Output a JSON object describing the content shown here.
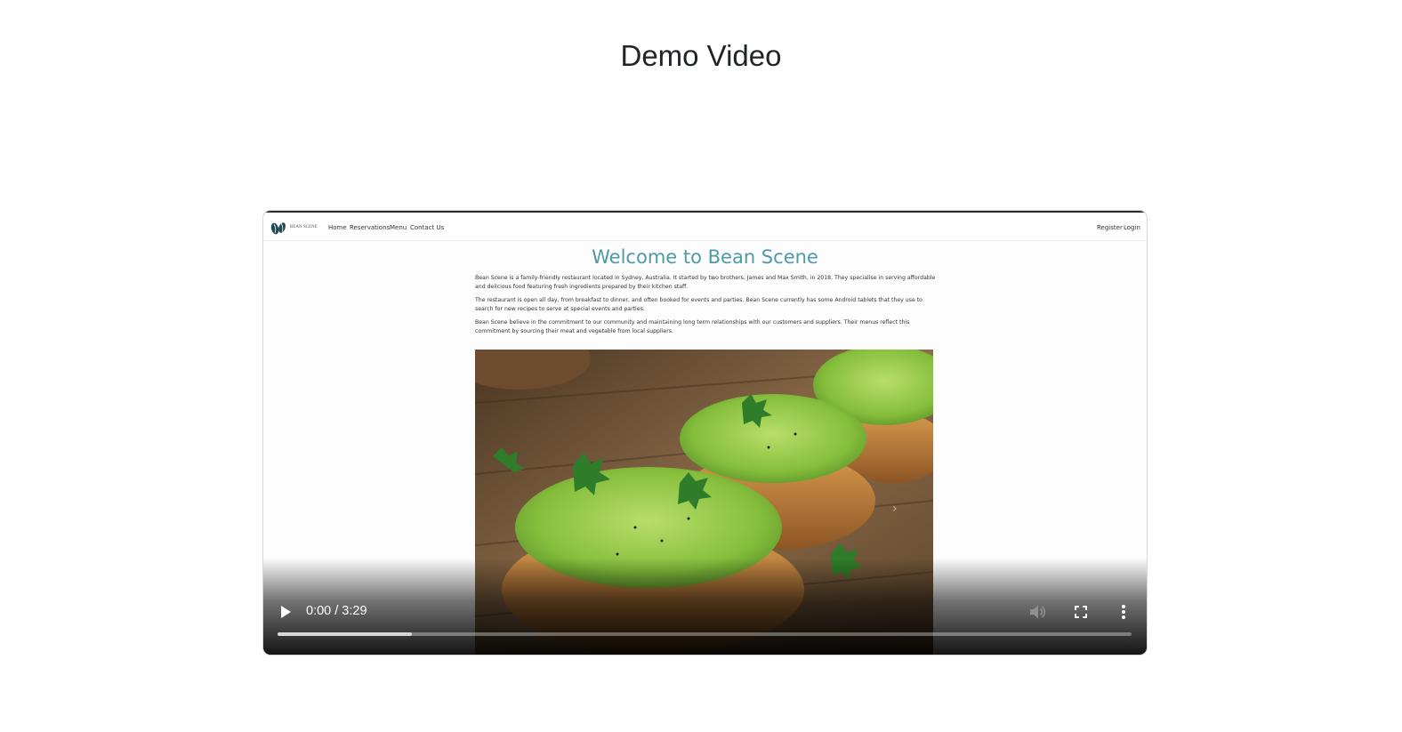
{
  "page": {
    "heading": "Demo Video"
  },
  "video": {
    "time": "0:00 / 3:29",
    "buffered_fraction": 0.157,
    "played_fraction": 0.0,
    "muted": true,
    "controls": {
      "play_icon": "play-icon",
      "volume_icon": "volume-muted-icon",
      "fullscreen_icon": "fullscreen-icon",
      "more_icon": "more-vert-icon"
    },
    "frame": {
      "site_nav": {
        "brand": "BEAN SCENE",
        "links": [
          "Home",
          "Reservations",
          "Menu",
          "Contact Us"
        ],
        "auth_links": [
          "Register",
          "Login"
        ]
      },
      "title": "Welcome to Bean Scene",
      "paragraphs": [
        "Bean Scene is a family-friendly restaurant located in Sydney, Australia. It started by two brothers, James and Max Smith, in 2018. They specialise in serving affordable and delicious food featuring fresh ingredients prepared by their kitchen staff.",
        "The restaurant is open all day, from breakfast to dinner, and often booked for events and parties. Bean Scene currently has some Android tablets that they use to search for new recipes to serve at special events and parties.",
        "Bean Scene believe in the commitment to our community and maintaining long term relationships with our customers and suppliers. Their menus reflect this commitment by sourcing their meat and vegetable from local suppliers."
      ],
      "carousel_next_glyph": "›"
    },
    "colors": {
      "title_teal": "#4e9aa8",
      "toast": "#c98a43",
      "avocado": "#8cc63f",
      "board": "#7a5a3a"
    }
  }
}
